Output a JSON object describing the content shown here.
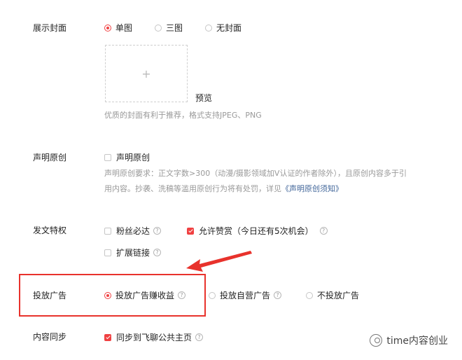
{
  "cover": {
    "label": "展示封面",
    "options": [
      "单图",
      "三图",
      "无封面"
    ],
    "selected": "单图",
    "plus": "+",
    "preview": "预览",
    "hint": "优质的封面有利于推荐，格式支持JPEG、PNG"
  },
  "original": {
    "label": "声明原创",
    "checkbox": "声明原创",
    "hint_line1": "声明原创要求：正文字数>300（动漫/摄影领域加V认证的作者除外），且原创内容多于引",
    "hint_line2_prefix": "用内容。抄袭、洗稿等滥用原创行为将有处罚，详见",
    "hint_link": "《声明原创须知》"
  },
  "privilege": {
    "label": "发文特权",
    "fans_only": "粉丝必达",
    "allow_reward": "允许赞赏（今日还有5次机会）",
    "extend_link": "扩展链接",
    "help": "?"
  },
  "ads": {
    "label": "投放广告",
    "options": [
      "投放广告赚收益",
      "投放自营广告",
      "不投放广告"
    ],
    "selected": "投放广告赚收益",
    "highlight_color": "#e8322c"
  },
  "sync": {
    "label": "内容同步",
    "checkbox": "同步到飞聊公共主页"
  },
  "watermark": {
    "text": "time内容创业"
  },
  "colors": {
    "accent": "#f04142",
    "link": "#406599",
    "hint": "#999999"
  }
}
